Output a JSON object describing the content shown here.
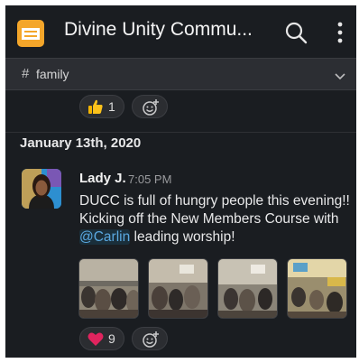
{
  "app": {
    "workspace_title": "Divine Unity Commu..."
  },
  "channel": {
    "hash": "#",
    "name": "family"
  },
  "prev_reaction": {
    "emoji": "thumbs-up",
    "count": "1"
  },
  "date_divider": "January 13th, 2020",
  "message": {
    "author": "Lady J.",
    "time": "7:05 PM",
    "text_before": "DUCC is full of hungry people this evening!! Kicking off the New Members Course with ",
    "mention": "@Carlin",
    "text_after": " leading worship!",
    "reaction": {
      "emoji": "red-heart",
      "count": "9"
    }
  },
  "colors": {
    "background": "#1a1d21",
    "channel_bar": "#2c2e33",
    "logo": "#f4a62a",
    "mention": "#5aa8e0",
    "heart": "#e0245e"
  },
  "icons": [
    "workspace-logo-icon",
    "search-icon",
    "more-vertical-icon",
    "chevron-down-icon",
    "thumbs-up-icon",
    "add-reaction-icon",
    "heart-icon"
  ]
}
